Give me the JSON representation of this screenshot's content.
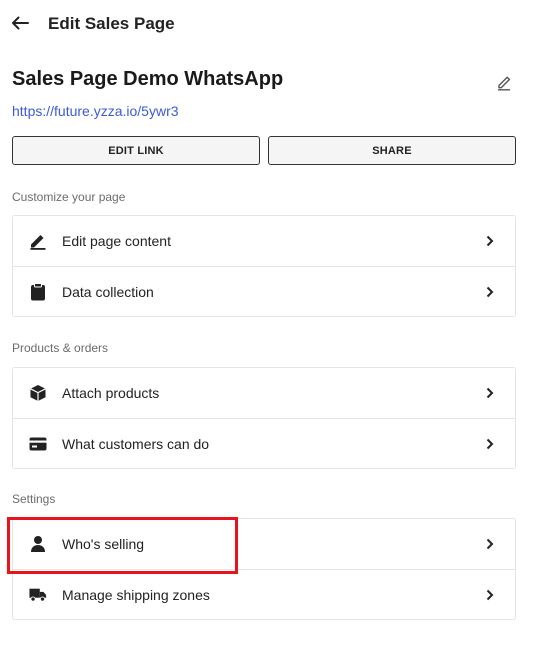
{
  "header": {
    "back_icon": "arrow-left-icon",
    "title": "Edit Sales Page"
  },
  "page": {
    "name": "Sales Page Demo WhatsApp",
    "edit_icon": "pencil-icon",
    "url": "https://future.yzza.io/5ywr3"
  },
  "actions": {
    "edit_link_label": "EDIT LINK",
    "share_label": "SHARE"
  },
  "sections": [
    {
      "label": "Customize your page",
      "items": [
        {
          "label": "Edit page content",
          "icon": "pencil-icon"
        },
        {
          "label": "Data collection",
          "icon": "clipboard-icon"
        }
      ]
    },
    {
      "label": "Products & orders",
      "items": [
        {
          "label": "Attach products",
          "icon": "box-icon"
        },
        {
          "label": "What customers can do",
          "icon": "credit-card-icon"
        }
      ]
    },
    {
      "label": "Settings",
      "items": [
        {
          "label": "Who's selling",
          "icon": "person-icon"
        },
        {
          "label": "Manage shipping zones",
          "icon": "truck-icon"
        }
      ]
    }
  ],
  "colors": {
    "link": "#3a5bd9",
    "highlight": "#e8141c",
    "border": "#e4e4e4"
  }
}
